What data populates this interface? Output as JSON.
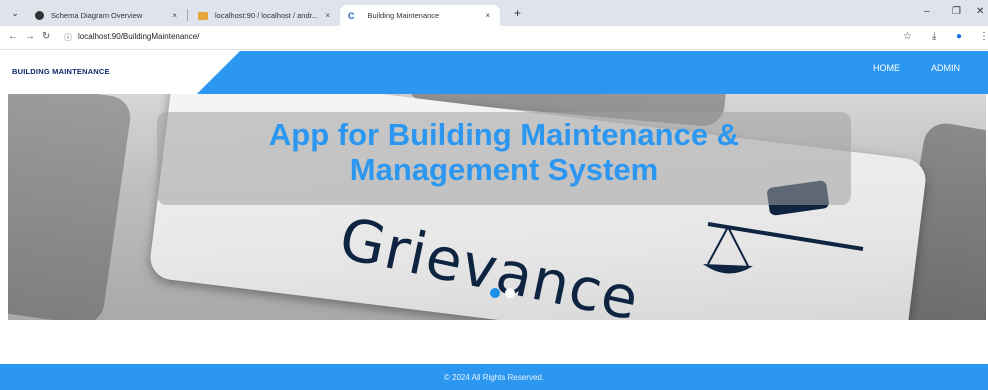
{
  "browser": {
    "tabs": [
      {
        "title": "Schema Diagram Overview",
        "close": "×"
      },
      {
        "title": "localhost:90 / localhost / andr...",
        "close": "×"
      },
      {
        "title": "Building Maintenance",
        "favicon": "C",
        "close": "×"
      }
    ],
    "new_tab": "+",
    "url": "localhost:90/BuildingMaintenance/",
    "window_controls": {
      "minimize": "–",
      "maximize": "❐",
      "close": "✕"
    },
    "nav": {
      "back": "←",
      "forward": "→",
      "reload": "↻",
      "site_info": "ⓘ"
    },
    "toolbar_icons": {
      "bookmark": "☆",
      "download": "⤓",
      "profile": "●",
      "menu": "⋮"
    }
  },
  "site": {
    "logo": "BUILDING MAINTENANCE",
    "nav": {
      "home": "HOME",
      "admin": "ADMIN"
    },
    "hero": {
      "title_line1": "App for Building Maintenance &",
      "title_line2": "Management System",
      "image_text": "Grievance",
      "carousel_slides": 2,
      "active_slide": 1
    },
    "footer": "© 2024 All Rights Reserved."
  },
  "colors": {
    "brand_blue": "#2b97f0",
    "logo_navy": "#0d2a6b",
    "active_dot": "#1e8fe8"
  }
}
